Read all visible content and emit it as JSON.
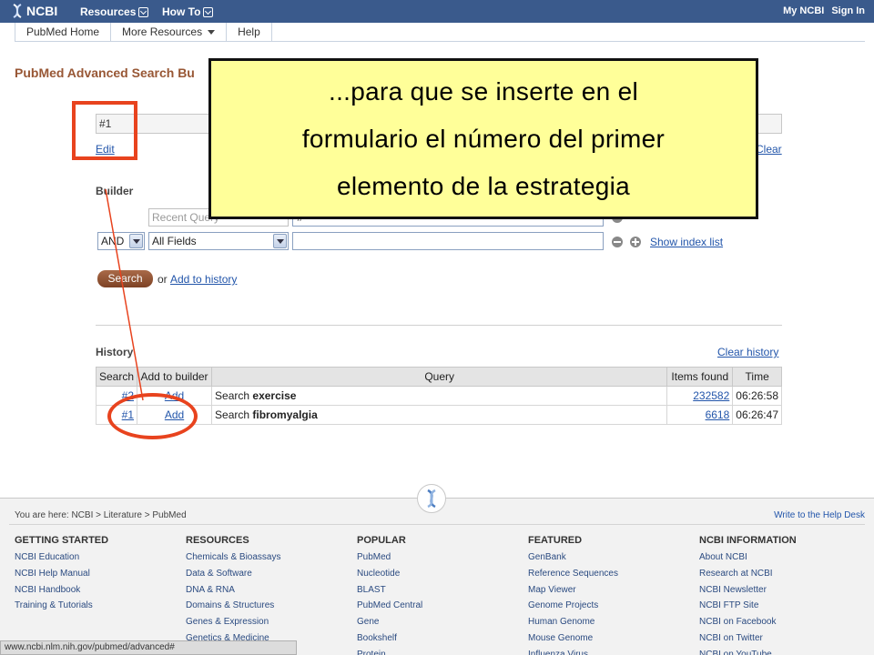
{
  "topbar": {
    "logo_text": "NCBI",
    "resources": "Resources",
    "howto": "How To",
    "my_ncbi": "My NCBI",
    "sign_in": "Sign In"
  },
  "navbar": {
    "tabs": [
      "PubMed Home",
      "More Resources",
      "Help"
    ]
  },
  "page_title": "PubMed Advanced Search Bu",
  "search_box": {
    "value": "#1"
  },
  "links": {
    "edit": "Edit",
    "clear": "Clear",
    "show_index": "Show index list",
    "add_history": "Add to history",
    "clear_history": "Clear history"
  },
  "builder": {
    "label": "Builder",
    "row1_field": "Recent Query",
    "row1_value": "#",
    "row2_op": "AND",
    "row2_field": "All Fields"
  },
  "search_button": "Search",
  "or_text": "or",
  "history": {
    "label": "History",
    "columns": [
      "Search",
      "Add to builder",
      "Query",
      "Items found",
      "Time"
    ],
    "rows": [
      {
        "num": "#2",
        "add": "Add",
        "prefix": "Search ",
        "term": "exercise",
        "items": "232582",
        "time": "06:26:58"
      },
      {
        "num": "#1",
        "add": "Add",
        "prefix": "Search ",
        "term": "fibromyalgia",
        "items": "6618",
        "time": "06:26:47"
      }
    ]
  },
  "callout": {
    "line1": "...para que se inserte en el",
    "line2": "formulario el número del primer",
    "line3": "elemento de la estrategia"
  },
  "footer": {
    "breadcrumb": "You are here: NCBI > Literature > PubMed",
    "help_desk": "Write to the Help Desk",
    "columns": [
      {
        "head": "GETTING STARTED",
        "items": [
          "NCBI Education",
          "NCBI Help Manual",
          "NCBI Handbook",
          "Training & Tutorials"
        ]
      },
      {
        "head": "RESOURCES",
        "items": [
          "Chemicals & Bioassays",
          "Data & Software",
          "DNA & RNA",
          "Domains & Structures",
          "Genes & Expression",
          "Genetics & Medicine"
        ]
      },
      {
        "head": "POPULAR",
        "items": [
          "PubMed",
          "Nucleotide",
          "BLAST",
          "PubMed Central",
          "Gene",
          "Bookshelf",
          "Protein"
        ]
      },
      {
        "head": "FEATURED",
        "items": [
          "GenBank",
          "Reference Sequences",
          "Map Viewer",
          "Genome Projects",
          "Human Genome",
          "Mouse Genome",
          "Influenza Virus"
        ]
      },
      {
        "head": "NCBI INFORMATION",
        "items": [
          "About NCBI",
          "Research at NCBI",
          "NCBI Newsletter",
          "NCBI FTP Site",
          "NCBI on Facebook",
          "NCBI on Twitter",
          "NCBI on YouTube"
        ]
      }
    ]
  },
  "status_bar": "www.ncbi.nlm.nih.gov/pubmed/advanced#",
  "colors": {
    "topbar": "#3a5a8c",
    "title": "#985735",
    "annotation_red": "#e8431e",
    "callout_yellow": "#ffff99"
  }
}
